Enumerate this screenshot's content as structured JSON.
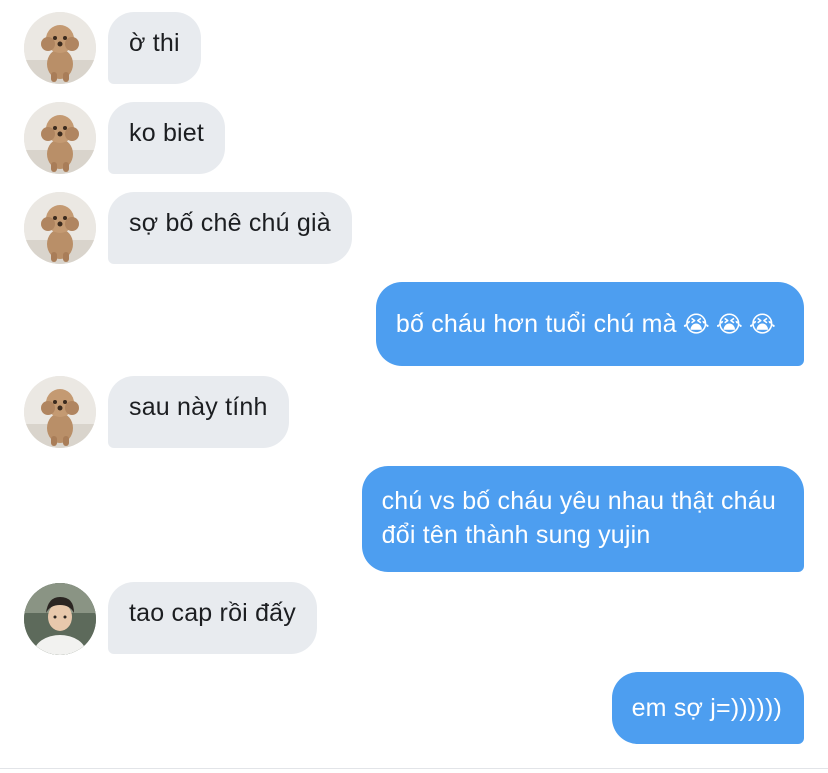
{
  "messages": [
    {
      "id": 1,
      "side": "in",
      "avatar": "poodle-avatar",
      "text": "ờ thi"
    },
    {
      "id": 2,
      "side": "in",
      "avatar": "poodle-avatar",
      "text": "ko biet"
    },
    {
      "id": 3,
      "side": "in",
      "avatar": "poodle-avatar",
      "text": "sợ bố chê chú già"
    },
    {
      "id": 4,
      "side": "out",
      "text": "bố cháu hơn tuổi chú mà",
      "emojis": [
        "😭",
        "😭",
        "😭"
      ]
    },
    {
      "id": 5,
      "side": "in",
      "avatar": "poodle-avatar",
      "text": "sau này tính"
    },
    {
      "id": 6,
      "side": "out",
      "lines": [
        "chú vs bố cháu yêu nhau thật cháu",
        "đổi tên thành sung yujin"
      ]
    },
    {
      "id": 7,
      "side": "in",
      "avatar": "person-avatar",
      "text": "tao cap rồi đấy"
    },
    {
      "id": 8,
      "side": "out",
      "text": "em sợ j=))))))"
    }
  ],
  "colors": {
    "incoming_bubble": "#e8ebef",
    "outgoing_bubble": "#4d9ef0",
    "incoming_text": "#1c1e21",
    "outgoing_text": "#ffffff"
  }
}
